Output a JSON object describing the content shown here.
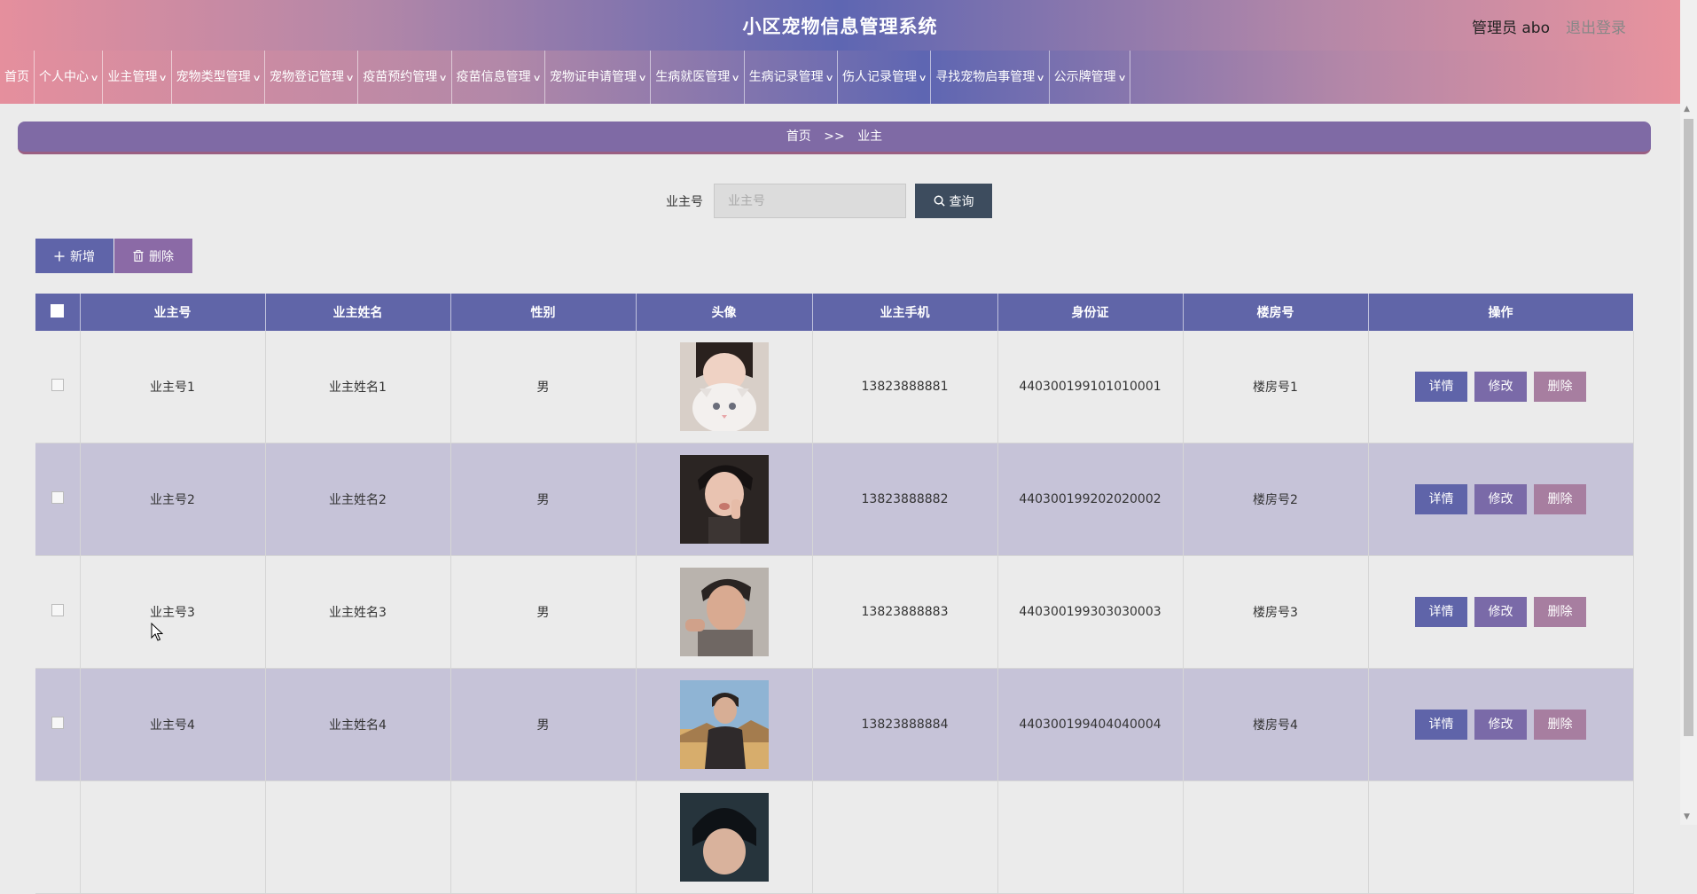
{
  "header": {
    "title": "小区宠物信息管理系统",
    "user": "管理员 abo",
    "logout": "退出登录"
  },
  "nav": [
    {
      "label": "首页",
      "dropdown": false
    },
    {
      "label": "个人中心",
      "dropdown": true
    },
    {
      "label": "业主管理",
      "dropdown": true
    },
    {
      "label": "宠物类型管理",
      "dropdown": true
    },
    {
      "label": "宠物登记管理",
      "dropdown": true
    },
    {
      "label": "疫苗预约管理",
      "dropdown": true
    },
    {
      "label": "疫苗信息管理",
      "dropdown": true
    },
    {
      "label": "宠物证申请管理",
      "dropdown": true
    },
    {
      "label": "生病就医管理",
      "dropdown": true
    },
    {
      "label": "生病记录管理",
      "dropdown": true
    },
    {
      "label": "伤人记录管理",
      "dropdown": true
    },
    {
      "label": "寻找宠物启事管理",
      "dropdown": true
    },
    {
      "label": "公示牌管理",
      "dropdown": true
    }
  ],
  "breadcrumb": {
    "home": "首页",
    "separator": ">>",
    "current": "业主"
  },
  "search": {
    "label": "业主号",
    "placeholder": "业主号",
    "button": "查询"
  },
  "actions": {
    "add": "新增",
    "delete": "删除"
  },
  "table": {
    "headers": [
      "业主号",
      "业主姓名",
      "性别",
      "头像",
      "业主手机",
      "身份证",
      "楼房号",
      "操作"
    ],
    "rows": [
      {
        "id": "业主号1",
        "name": "业主姓名1",
        "gender": "男",
        "avatar": "photo-girl-with-white-cat",
        "phone": "13823888881",
        "idcard": "440300199101010001",
        "building": "楼房号1"
      },
      {
        "id": "业主号2",
        "name": "业主姓名2",
        "gender": "男",
        "avatar": "photo-young-man-peace-sign",
        "phone": "13823888882",
        "idcard": "440300199202020002",
        "building": "楼房号2"
      },
      {
        "id": "业主号3",
        "name": "业主姓名3",
        "gender": "男",
        "avatar": "photo-man-selfie",
        "phone": "13823888883",
        "idcard": "440300199303030003",
        "building": "楼房号3"
      },
      {
        "id": "业主号4",
        "name": "业主姓名4",
        "gender": "男",
        "avatar": "photo-man-outdoor-sunset",
        "phone": "13823888884",
        "idcard": "440300199404040004",
        "building": "楼房号4"
      },
      {
        "id": "",
        "name": "",
        "gender": "",
        "avatar": "photo-man-dark-hair",
        "phone": "",
        "idcard": "",
        "building": ""
      }
    ],
    "op_buttons": {
      "detail": "详情",
      "edit": "修改",
      "delete": "删除"
    }
  },
  "colors": {
    "header_pink": "#e58f9d",
    "header_blue": "#5e66b2",
    "table_header": "#6065a8",
    "row_alt": "#c6c3d8",
    "btn_detail": "#5f64a9",
    "btn_edit": "#7a6aa8",
    "btn_delete": "#a77ea0"
  }
}
